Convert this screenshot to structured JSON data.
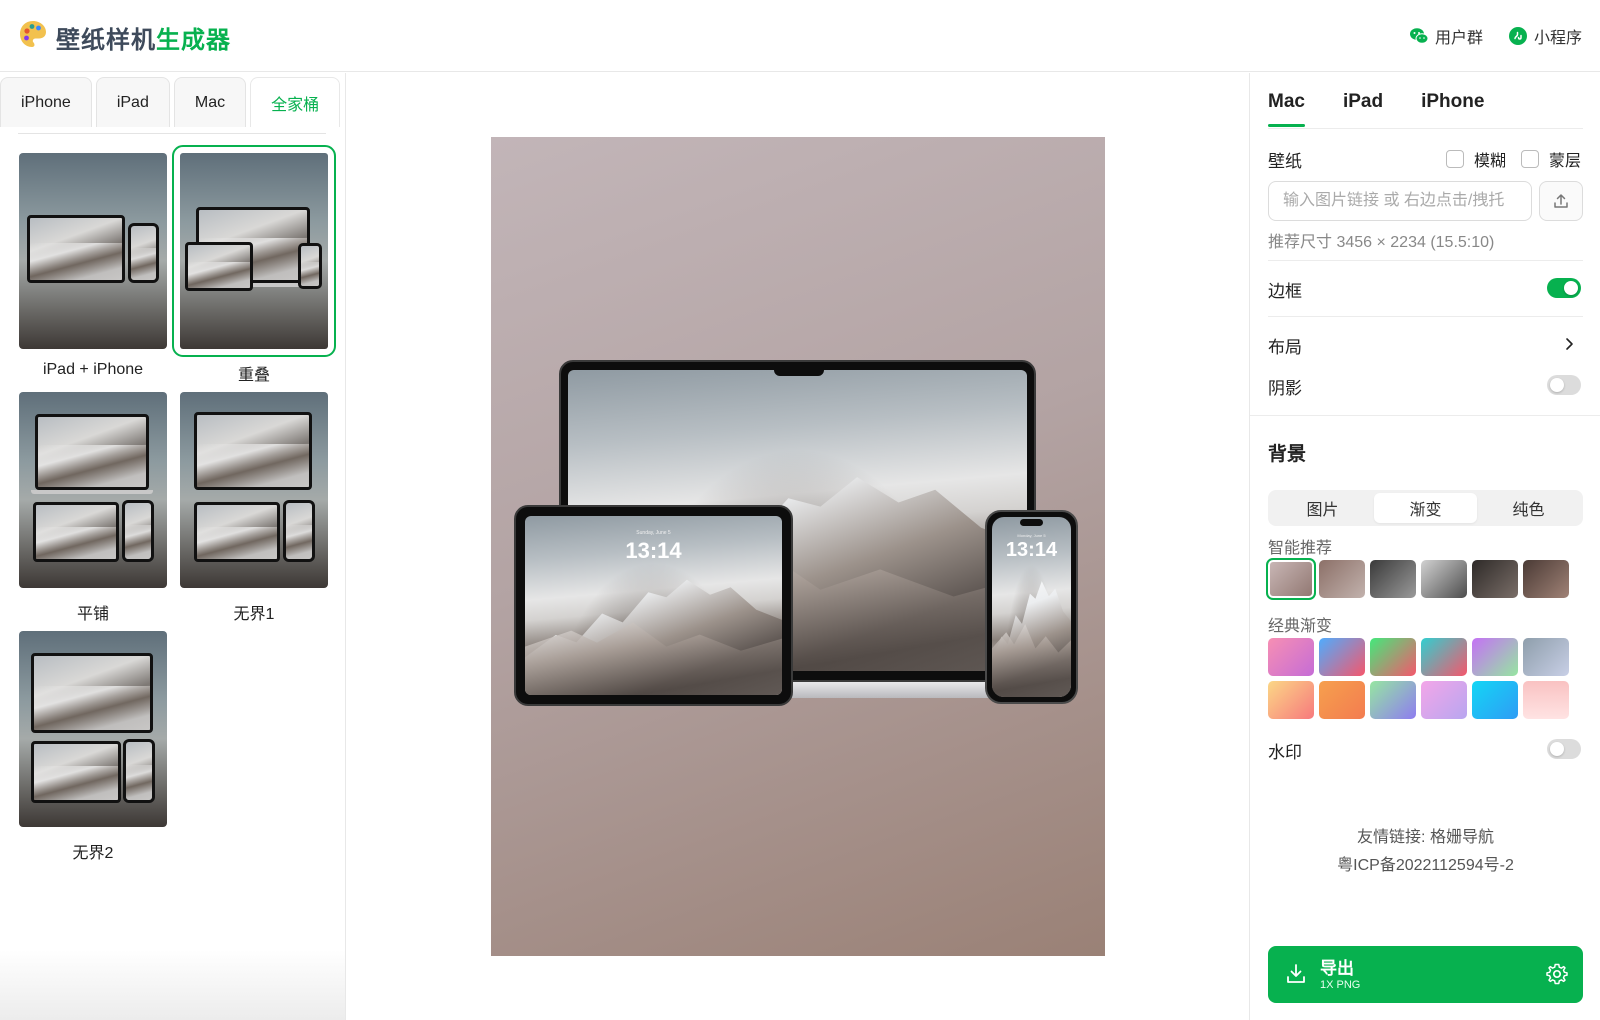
{
  "header": {
    "brand_part1": "壁纸样机",
    "brand_part2": "生成器",
    "logo_icon": "palette-icon",
    "links": [
      {
        "label": "用户群",
        "icon": "wechat-icon"
      },
      {
        "label": "小程序",
        "icon": "miniprogram-icon"
      }
    ]
  },
  "left": {
    "tabs": [
      "iPhone",
      "iPad",
      "Mac",
      "全家桶"
    ],
    "active_tab": "全家桶",
    "layouts": [
      {
        "label": "iPad + iPhone",
        "selected": false
      },
      {
        "label": "重叠",
        "selected": true
      },
      {
        "label": "平铺",
        "selected": false
      },
      {
        "label": "无界1",
        "selected": false
      },
      {
        "label": "无界2",
        "selected": false
      }
    ]
  },
  "preview": {
    "ipad_time": "13:14",
    "ipad_date": "Sunday, June 5",
    "iphone_time": "13:14",
    "iphone_date": "Monday, June 5"
  },
  "right": {
    "device_tabs": [
      "Mac",
      "iPad",
      "iPhone"
    ],
    "active_device": "Mac",
    "wallpaper": {
      "label": "壁纸",
      "blur_label": "模糊",
      "mask_label": "蒙层",
      "url_placeholder": "输入图片链接 或 右边点击/拽托",
      "hint": "推荐尺寸 3456 × 2234 (15.5:10)",
      "upload_icon": "upload-icon"
    },
    "frame": {
      "label": "边框",
      "on": true
    },
    "layout": {
      "label": "布局",
      "icon": "chevron-right-icon"
    },
    "shadow": {
      "label": "阴影",
      "on": false
    },
    "background": {
      "title": "背景",
      "segments": [
        "图片",
        "渐变",
        "纯色"
      ],
      "active_segment": "渐变",
      "smart_label": "智能推荐",
      "smart_swatches": [
        "linear-gradient(135deg,#cbb9b8,#8f756f)",
        "linear-gradient(135deg,#8c7068,#c2b2ad)",
        "linear-gradient(135deg,#3a3a3a,#9a9a9a)",
        "linear-gradient(135deg,#d2d2d2,#4c4c4c)",
        "linear-gradient(135deg,#2e2a28,#7a6e68)",
        "linear-gradient(135deg,#4a3a35,#a08276)"
      ],
      "classic_label": "经典渐变",
      "classic_swatches": [
        "linear-gradient(135deg,#f78fb3,#c56cd6)",
        "linear-gradient(135deg,#4facfe,#f5576c)",
        "linear-gradient(135deg,#43e97b,#f5576c)",
        "linear-gradient(135deg,#30cfd0,#f5576c)",
        "linear-gradient(135deg,#c471f5,#96e6a1)",
        "linear-gradient(135deg,#8e9eab,#c8cfe6)",
        "linear-gradient(135deg,#fbd786,#f7797d)",
        "linear-gradient(135deg,#f6a04d,#f37c50)",
        "linear-gradient(135deg,#96e6a1,#8e7cf0)",
        "linear-gradient(135deg,#f3a6e8,#b8a6f0)",
        "linear-gradient(135deg,#13d6f5,#2f9cf5)",
        "linear-gradient(180deg,#f9c2c2,#ffe3e3)"
      ]
    },
    "watermark": {
      "label": "水印",
      "on": false
    },
    "footer": {
      "friend_links": "友情链接: 格姗导航",
      "icp": "粤ICP备2022112594号-2"
    },
    "export": {
      "title": "导出",
      "subtitle": "1X PNG",
      "icon": "download-icon",
      "settings_icon": "gear-icon"
    }
  }
}
